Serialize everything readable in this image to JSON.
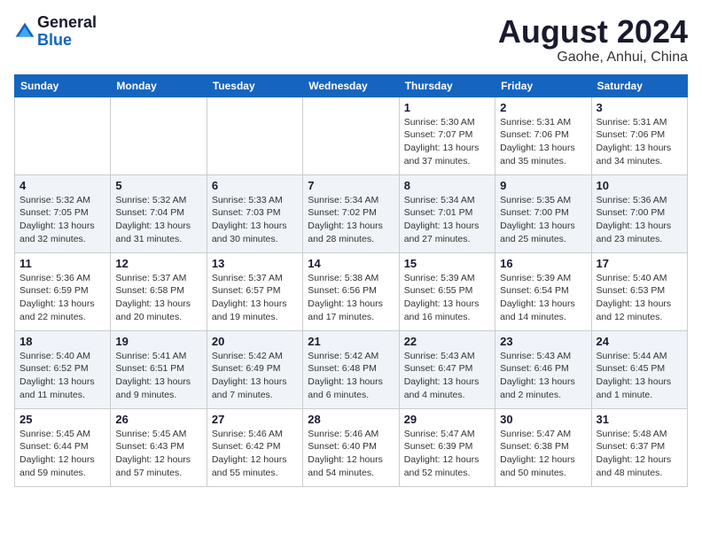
{
  "header": {
    "logo_general": "General",
    "logo_blue": "Blue",
    "month_title": "August 2024",
    "location": "Gaohe, Anhui, China"
  },
  "days_of_week": [
    "Sunday",
    "Monday",
    "Tuesday",
    "Wednesday",
    "Thursday",
    "Friday",
    "Saturday"
  ],
  "weeks": [
    [
      {
        "day": "",
        "info": ""
      },
      {
        "day": "",
        "info": ""
      },
      {
        "day": "",
        "info": ""
      },
      {
        "day": "",
        "info": ""
      },
      {
        "day": "1",
        "info": "Sunrise: 5:30 AM\nSunset: 7:07 PM\nDaylight: 13 hours\nand 37 minutes."
      },
      {
        "day": "2",
        "info": "Sunrise: 5:31 AM\nSunset: 7:06 PM\nDaylight: 13 hours\nand 35 minutes."
      },
      {
        "day": "3",
        "info": "Sunrise: 5:31 AM\nSunset: 7:06 PM\nDaylight: 13 hours\nand 34 minutes."
      }
    ],
    [
      {
        "day": "4",
        "info": "Sunrise: 5:32 AM\nSunset: 7:05 PM\nDaylight: 13 hours\nand 32 minutes."
      },
      {
        "day": "5",
        "info": "Sunrise: 5:32 AM\nSunset: 7:04 PM\nDaylight: 13 hours\nand 31 minutes."
      },
      {
        "day": "6",
        "info": "Sunrise: 5:33 AM\nSunset: 7:03 PM\nDaylight: 13 hours\nand 30 minutes."
      },
      {
        "day": "7",
        "info": "Sunrise: 5:34 AM\nSunset: 7:02 PM\nDaylight: 13 hours\nand 28 minutes."
      },
      {
        "day": "8",
        "info": "Sunrise: 5:34 AM\nSunset: 7:01 PM\nDaylight: 13 hours\nand 27 minutes."
      },
      {
        "day": "9",
        "info": "Sunrise: 5:35 AM\nSunset: 7:00 PM\nDaylight: 13 hours\nand 25 minutes."
      },
      {
        "day": "10",
        "info": "Sunrise: 5:36 AM\nSunset: 7:00 PM\nDaylight: 13 hours\nand 23 minutes."
      }
    ],
    [
      {
        "day": "11",
        "info": "Sunrise: 5:36 AM\nSunset: 6:59 PM\nDaylight: 13 hours\nand 22 minutes."
      },
      {
        "day": "12",
        "info": "Sunrise: 5:37 AM\nSunset: 6:58 PM\nDaylight: 13 hours\nand 20 minutes."
      },
      {
        "day": "13",
        "info": "Sunrise: 5:37 AM\nSunset: 6:57 PM\nDaylight: 13 hours\nand 19 minutes."
      },
      {
        "day": "14",
        "info": "Sunrise: 5:38 AM\nSunset: 6:56 PM\nDaylight: 13 hours\nand 17 minutes."
      },
      {
        "day": "15",
        "info": "Sunrise: 5:39 AM\nSunset: 6:55 PM\nDaylight: 13 hours\nand 16 minutes."
      },
      {
        "day": "16",
        "info": "Sunrise: 5:39 AM\nSunset: 6:54 PM\nDaylight: 13 hours\nand 14 minutes."
      },
      {
        "day": "17",
        "info": "Sunrise: 5:40 AM\nSunset: 6:53 PM\nDaylight: 13 hours\nand 12 minutes."
      }
    ],
    [
      {
        "day": "18",
        "info": "Sunrise: 5:40 AM\nSunset: 6:52 PM\nDaylight: 13 hours\nand 11 minutes."
      },
      {
        "day": "19",
        "info": "Sunrise: 5:41 AM\nSunset: 6:51 PM\nDaylight: 13 hours\nand 9 minutes."
      },
      {
        "day": "20",
        "info": "Sunrise: 5:42 AM\nSunset: 6:49 PM\nDaylight: 13 hours\nand 7 minutes."
      },
      {
        "day": "21",
        "info": "Sunrise: 5:42 AM\nSunset: 6:48 PM\nDaylight: 13 hours\nand 6 minutes."
      },
      {
        "day": "22",
        "info": "Sunrise: 5:43 AM\nSunset: 6:47 PM\nDaylight: 13 hours\nand 4 minutes."
      },
      {
        "day": "23",
        "info": "Sunrise: 5:43 AM\nSunset: 6:46 PM\nDaylight: 13 hours\nand 2 minutes."
      },
      {
        "day": "24",
        "info": "Sunrise: 5:44 AM\nSunset: 6:45 PM\nDaylight: 13 hours\nand 1 minute."
      }
    ],
    [
      {
        "day": "25",
        "info": "Sunrise: 5:45 AM\nSunset: 6:44 PM\nDaylight: 12 hours\nand 59 minutes."
      },
      {
        "day": "26",
        "info": "Sunrise: 5:45 AM\nSunset: 6:43 PM\nDaylight: 12 hours\nand 57 minutes."
      },
      {
        "day": "27",
        "info": "Sunrise: 5:46 AM\nSunset: 6:42 PM\nDaylight: 12 hours\nand 55 minutes."
      },
      {
        "day": "28",
        "info": "Sunrise: 5:46 AM\nSunset: 6:40 PM\nDaylight: 12 hours\nand 54 minutes."
      },
      {
        "day": "29",
        "info": "Sunrise: 5:47 AM\nSunset: 6:39 PM\nDaylight: 12 hours\nand 52 minutes."
      },
      {
        "day": "30",
        "info": "Sunrise: 5:47 AM\nSunset: 6:38 PM\nDaylight: 12 hours\nand 50 minutes."
      },
      {
        "day": "31",
        "info": "Sunrise: 5:48 AM\nSunset: 6:37 PM\nDaylight: 12 hours\nand 48 minutes."
      }
    ]
  ]
}
